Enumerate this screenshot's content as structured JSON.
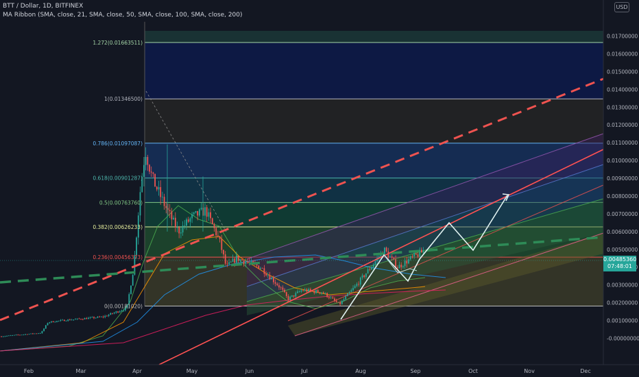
{
  "header": {
    "symbol": "BTT / Dollar, 1D, BITFINEX",
    "indicator": "MA Ribbon (SMA, close, 21, SMA, close, 50, SMA, close, 100, SMA, close, 200)"
  },
  "currency_badge": "USD",
  "last_price": {
    "price": "0.00485360",
    "countdown": "07:48:01"
  },
  "colors": {
    "background": "#131722",
    "up": "#26a69a",
    "down": "#ef5350",
    "trend_dash": "#ef5350",
    "ma_dash": "#2e8b57"
  },
  "chart_data": {
    "type": "candlestick",
    "x_tick_labels": [
      "Feb",
      "Mar",
      "Apr",
      "May",
      "Jun",
      "Jul",
      "Aug",
      "Sep",
      "Oct",
      "Nov",
      "Dec"
    ],
    "y_tick_labels": [
      "0.01700000",
      "0.01600000",
      "0.01500000",
      "0.01400000",
      "0.01300000",
      "0.01200000",
      "0.01100000",
      "0.01000000",
      "0.00900000",
      "0.00800000",
      "0.00700000",
      "0.00600000",
      "0.00500000",
      "0.00400000",
      "0.00300000",
      "0.00200000",
      "0.00100000",
      "-0.00000000"
    ],
    "ylim": [
      -0.0001,
      0.0178
    ],
    "fib_levels": [
      {
        "ratio": "1.272",
        "value": 0.01663511,
        "label": "1.272(0.01663511)",
        "color": "#a5d6a7"
      },
      {
        "ratio": "1",
        "value": 0.013465,
        "label": "1(0.01346500)",
        "color": "#b2b5be"
      },
      {
        "ratio": "0.786",
        "value": 0.01097087,
        "label": "0.786(0.01097087)",
        "color": "#64b5f6"
      },
      {
        "ratio": "0.618",
        "value": 0.00901287,
        "label": "0.618(0.00901287)",
        "color": "#4db6ac"
      },
      {
        "ratio": "0.5",
        "value": 0.0076376,
        "label": "0.5(0.00763760)",
        "color": "#81c784"
      },
      {
        "ratio": "0.382",
        "value": 0.00626233,
        "label": "0.382(0.00626233)",
        "color": "#e6ee9c"
      },
      {
        "ratio": "0.236",
        "value": 0.00456373,
        "label": "0.236(0.00456373)",
        "color": "#ef5350"
      },
      {
        "ratio": "0",
        "value": 0.0018102,
        "label": "0(0.00181020)",
        "color": "#bdbdbd"
      }
    ]
  }
}
